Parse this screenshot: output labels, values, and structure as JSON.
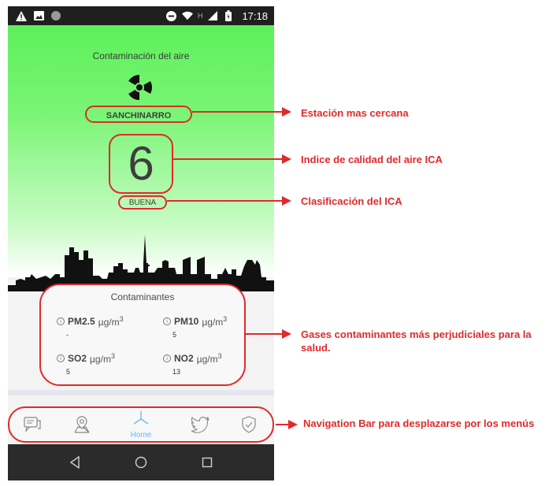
{
  "status_bar": {
    "time": "17:18",
    "network_letter": "H",
    "icons": [
      "warning-icon",
      "image-icon",
      "circle-icon",
      "do-not-disturb-icon",
      "wifi-icon",
      "signal-icon",
      "battery-icon"
    ]
  },
  "air_quality": {
    "title": "Contaminación del aire",
    "icon": "radiation-icon",
    "station": "SANCHINARRO",
    "ica_value": "6",
    "classification": "BUENA",
    "background_color": "#5df05a"
  },
  "pollutants": {
    "title": "Contaminantes",
    "items": [
      {
        "name": "PM2.5",
        "unit": "µg/m",
        "unit_exp": "3",
        "value": "-"
      },
      {
        "name": "PM10",
        "unit": "µg/m",
        "unit_exp": "3",
        "value": "5"
      },
      {
        "name": "SO2",
        "unit": "µg/m",
        "unit_exp": "3",
        "value": "5"
      },
      {
        "name": "NO2",
        "unit": "µg/m",
        "unit_exp": "3",
        "value": "13"
      }
    ]
  },
  "nav_bar": {
    "items": [
      {
        "icon": "chat-icon"
      },
      {
        "icon": "map-pin-icon"
      },
      {
        "icon": "home-icon",
        "label": "Home",
        "active": true
      },
      {
        "icon": "twitter-icon"
      },
      {
        "icon": "shield-check-icon"
      }
    ],
    "active_color": "#6ab8e8"
  },
  "system_nav": {
    "icons": [
      "back-icon",
      "home-circle-icon",
      "recents-icon"
    ]
  },
  "annotations": [
    "Estación mas cercana",
    "Indice de calidad del aire ICA",
    "Clasificación del ICA",
    "Gases contaminantes más perjudiciales para la salud.",
    "Navigation Bar para desplazarse por los menús"
  ],
  "colors": {
    "annotation_red": "#e02a2a"
  }
}
